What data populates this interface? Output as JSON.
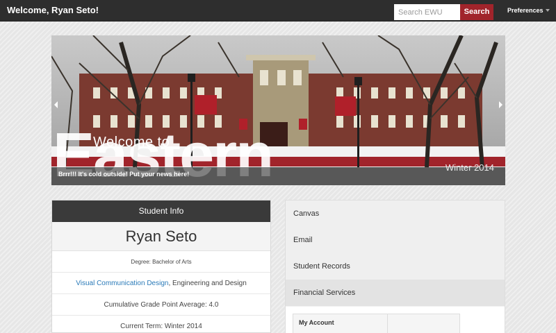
{
  "topbar": {
    "welcome": "Welcome, Ryan Seto!",
    "search_placeholder": "Search EWU",
    "search_button": "Search",
    "preferences": "Preferences"
  },
  "hero": {
    "welcome_to": "Welcome to",
    "eastern": "Eastern",
    "term": "Winter 2014",
    "news": "Brrr!!! It's cold outside! Put your news here!"
  },
  "student_info": {
    "heading": "Student Info",
    "name": "Ryan Seto",
    "degree": "Degree: Bachelor of Arts",
    "major_link": "Visual Communication Design",
    "major_rest": ", Engineering and Design",
    "gpa": "Cumulative Grade Point Average: 4.0",
    "current_term": "Current Term: Winter 2014"
  },
  "quick_links": {
    "items": [
      {
        "label": "Canvas"
      },
      {
        "label": "Email"
      },
      {
        "label": "Student Records"
      },
      {
        "label": "Financial Services"
      }
    ],
    "account_label": "My Account"
  },
  "colors": {
    "topbar": "#2e2e2e",
    "accent_red": "#a1242b",
    "link_blue": "#2a7ab8"
  },
  "icons": [
    "chevron-left-icon",
    "chevron-right-icon",
    "caret-down-icon"
  ]
}
